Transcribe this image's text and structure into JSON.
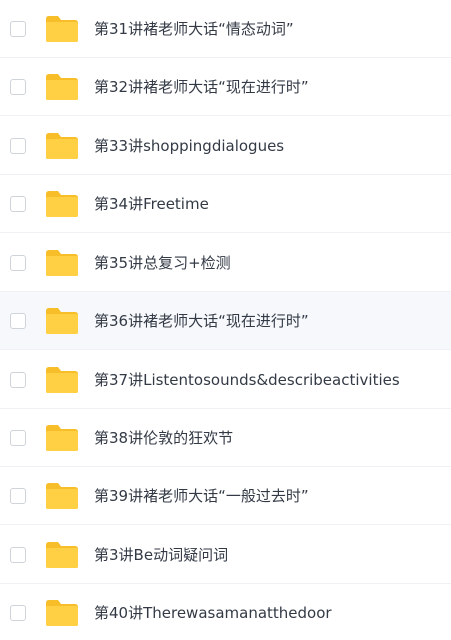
{
  "files": [
    {
      "name": "第31讲褚老师大话“情态动词”"
    },
    {
      "name": "第32讲褚老师大话“现在进行时”"
    },
    {
      "name": "第33讲shoppingdialogues"
    },
    {
      "name": "第34讲Freetime"
    },
    {
      "name": "第35讲总复习+检测"
    },
    {
      "name": "第36讲褚老师大话“现在进行时”"
    },
    {
      "name": "第37讲Listentosounds&describeactivities"
    },
    {
      "name": "第38讲伦敦的狂欢节"
    },
    {
      "name": "第39讲褚老师大话“一般过去时”"
    },
    {
      "name": "第3讲Be动词疑问词"
    },
    {
      "name": "第40讲Therewasamanatthedoor"
    }
  ],
  "highlighted_index": 5,
  "colors": {
    "folder_body": "#ffd044",
    "folder_tab": "#f7be2a",
    "text": "#333a45",
    "highlight_row": "#f6f8fc"
  },
  "icons": {
    "folder": "folder-icon",
    "checkbox": "checkbox-icon"
  }
}
